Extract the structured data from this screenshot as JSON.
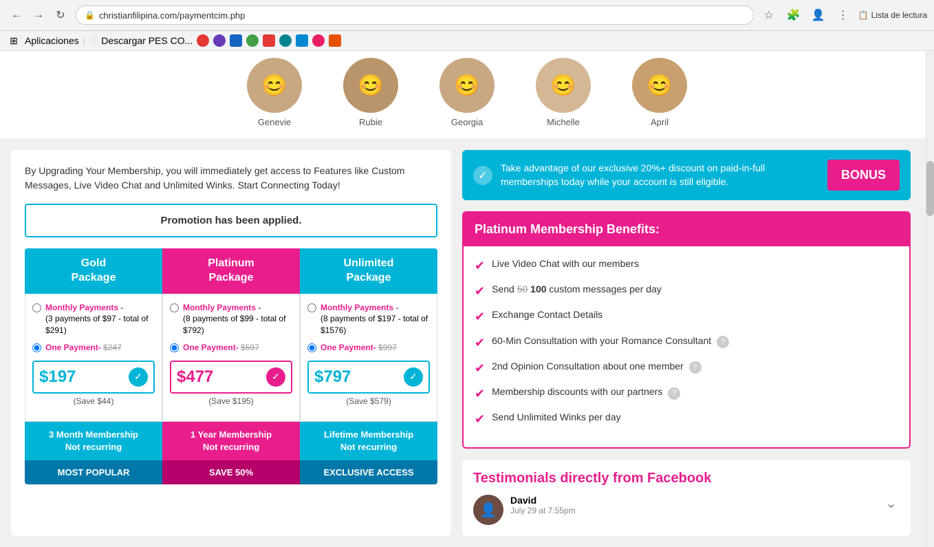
{
  "browser": {
    "url": "christianfilipina.com/paymentcim.php",
    "read_list": "Lista de lectura",
    "bookmarks": [
      "Aplicaciones",
      "Descargar PES CO...",
      "bookmark3",
      "bookmark4",
      "bookmark5",
      "bookmark6",
      "bookmark7",
      "bookmark8",
      "bookmark9",
      "bookmark10"
    ]
  },
  "profiles": [
    {
      "name": "Genevie",
      "color": "#c8a882"
    },
    {
      "name": "Rubie",
      "color": "#c8a882"
    },
    {
      "name": "Georgia",
      "color": "#c8a882"
    },
    {
      "name": "Michelle",
      "color": "#c8a882"
    },
    {
      "name": "April",
      "color": "#c8a882"
    }
  ],
  "intro": {
    "text": "By Upgrading Your Membership, you will immediately get access to Features like Custom Messages, Live Video Chat and Unlimited Winks. Start Connecting Today!"
  },
  "promo": {
    "text": "Promotion has been applied."
  },
  "packages": [
    {
      "id": "gold",
      "title": "Gold Package",
      "color": "blue",
      "monthly_label": "Monthly Payments -",
      "monthly_sub": "(3 payments of $97 - total of $291)",
      "one_payment_label": "One Payment-",
      "one_payment_strike": "$247",
      "price": "$197",
      "save": "(Save $44)",
      "membership_line1": "3 Month Membership",
      "membership_line2": "Not recurring",
      "badge": "MOST POPULAR",
      "monthly_selected": false,
      "onepay_selected": true
    },
    {
      "id": "platinum",
      "title": "Platinum Package",
      "color": "pink",
      "monthly_label": "Monthly Payments -",
      "monthly_sub": "(8 payments of $99 - total of $792)",
      "one_payment_label": "One Payment-",
      "one_payment_strike": "$597",
      "price": "$477",
      "save": "(Save $195)",
      "membership_line1": "1 Year Membership",
      "membership_line2": "Not recurring",
      "badge": "SAVE 50%",
      "monthly_selected": false,
      "onepay_selected": true
    },
    {
      "id": "unlimited",
      "title": "Unlimited Package",
      "color": "blue",
      "monthly_label": "Monthly Payments -",
      "monthly_sub": "(8 payments of $197 - total of $1576)",
      "one_payment_label": "One Payment-",
      "one_payment_strike": "$997",
      "price": "$797",
      "save": "(Save $579)",
      "membership_line1": "Lifetime Membership",
      "membership_line2": "Not recurring",
      "badge": "EXCLUSIVE ACCESS",
      "monthly_selected": false,
      "onepay_selected": true
    }
  ],
  "bonus": {
    "text": "Take advantage of our exclusive 20%+ discount on paid-in-full memberships today while your account is still eligible.",
    "button": "BONUS"
  },
  "benefits": {
    "title": "Platinum Membership Benefits:",
    "items": [
      {
        "text": "Live Video Chat with our members",
        "has_help": false
      },
      {
        "text": "Send 50 100 custom messages per day",
        "has_help": false,
        "has_strike": true
      },
      {
        "text": "Exchange Contact Details",
        "has_help": false
      },
      {
        "text": "60-Min Consultation with your Romance Consultant",
        "has_help": true
      },
      {
        "text": "2nd Opinion Consultation about one member",
        "has_help": true
      },
      {
        "text": "Membership discounts with our partners",
        "has_help": true
      },
      {
        "text": "Send Unlimited Winks per day",
        "has_help": false
      }
    ]
  },
  "testimonials": {
    "title": "Testimonials directly from Facebook",
    "items": [
      {
        "name": "David",
        "date": "July 29 at 7:55pm"
      }
    ]
  }
}
